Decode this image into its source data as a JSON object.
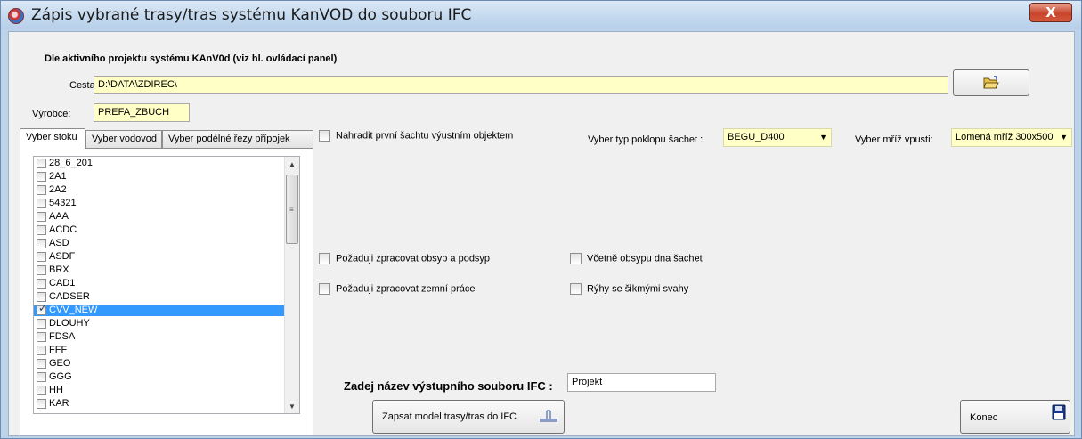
{
  "window": {
    "title": "Zápis vybrané trasy/tras systému KanVOD do souboru IFC",
    "close_label": "X"
  },
  "header": {
    "project_heading": "Dle aktivního projektu systému KAnV0d (viz hl. ovládací panel)"
  },
  "path": {
    "label": "Cesta:",
    "value": "D:\\DATA\\ZDIREC\\"
  },
  "manufacturer": {
    "label": "Výrobce:",
    "value": "PREFA_ZBUCH"
  },
  "tabs": [
    {
      "label": "Vyber stoku",
      "active": true
    },
    {
      "label": "Vyber vodovod",
      "active": false
    },
    {
      "label": "Vyber podélné řezy přípojek",
      "active": false
    }
  ],
  "sewer_list": {
    "items": [
      {
        "label": "28_6_201",
        "checked": false,
        "selected": false
      },
      {
        "label": "2A1",
        "checked": false,
        "selected": false
      },
      {
        "label": "2A2",
        "checked": false,
        "selected": false
      },
      {
        "label": "54321",
        "checked": false,
        "selected": false
      },
      {
        "label": "AAA",
        "checked": false,
        "selected": false
      },
      {
        "label": "ACDC",
        "checked": false,
        "selected": false
      },
      {
        "label": "ASD",
        "checked": false,
        "selected": false
      },
      {
        "label": "ASDF",
        "checked": false,
        "selected": false
      },
      {
        "label": "BRX",
        "checked": false,
        "selected": false
      },
      {
        "label": "CAD1",
        "checked": false,
        "selected": false
      },
      {
        "label": "CADSER",
        "checked": false,
        "selected": false
      },
      {
        "label": "CVV_NEW",
        "checked": true,
        "selected": true
      },
      {
        "label": "DLOUHY",
        "checked": false,
        "selected": false
      },
      {
        "label": "FDSA",
        "checked": false,
        "selected": false
      },
      {
        "label": "FFF",
        "checked": false,
        "selected": false
      },
      {
        "label": "GEO",
        "checked": false,
        "selected": false
      },
      {
        "label": "GGG",
        "checked": false,
        "selected": false
      },
      {
        "label": "HH",
        "checked": false,
        "selected": false
      },
      {
        "label": "KAR",
        "checked": false,
        "selected": false
      }
    ]
  },
  "options": {
    "replace_first_shaft": "Nahradit první šachtu výustním objektem",
    "process_bedding": "Požaduji zpracovat obsyp a podsyp",
    "process_earthworks": "Požaduji zpracovat zemní práce",
    "include_shaft_bottom": "Včetně obsypu dna šachet",
    "sloped_trenches": "Rýhy se šikmými svahy"
  },
  "shaft_cover": {
    "label": "Vyber typ poklopu šachet :",
    "value": "BEGU_D400"
  },
  "inlet_grate": {
    "label": "Vyber mříž vpusti:",
    "value": "Lomená mříž 300x500"
  },
  "output_file": {
    "label": "Zadej název výstupního souboru IFC :",
    "value": "Projekt"
  },
  "buttons": {
    "write_model": "Zapsat model trasy/tras do IFC",
    "close": "Konec"
  },
  "icons": {
    "folder": "folder-open-icon",
    "pipe": "pipe-icon",
    "floppy": "floppy-disk-icon"
  }
}
